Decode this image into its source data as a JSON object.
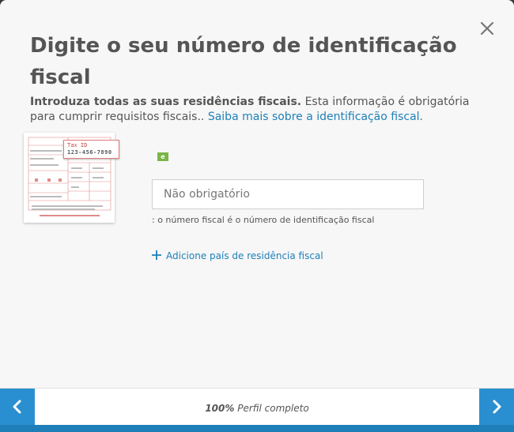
{
  "dialog": {
    "title": "Digite o seu número de identificação fiscal",
    "intro_bold": "Introduza todas as suas residências fiscais.",
    "intro_text": " Esta informação é obrigatória para cumprir requisitos fiscais.. ",
    "learn_more_link": "Saiba mais sobre a identificação fiscal.",
    "close_icon": "close-icon"
  },
  "form_image": {
    "taxid_label": "Tax ID",
    "taxid_number": "123-456-7890"
  },
  "field": {
    "badge": "e",
    "placeholder": "Não obrigatório",
    "value": "",
    "hint": ": o número fiscal é o número de identificação fiscal"
  },
  "add_country": {
    "icon": "plus-icon",
    "label": "Adicione país de residência fiscal"
  },
  "footer": {
    "progress_percent_label": "100%",
    "progress_text": " Perfil completo",
    "progress_value": 1.0,
    "prev_icon": "chevron-left-icon",
    "next_icon": "chevron-right-icon",
    "accent_color": "#2a8fd0"
  }
}
